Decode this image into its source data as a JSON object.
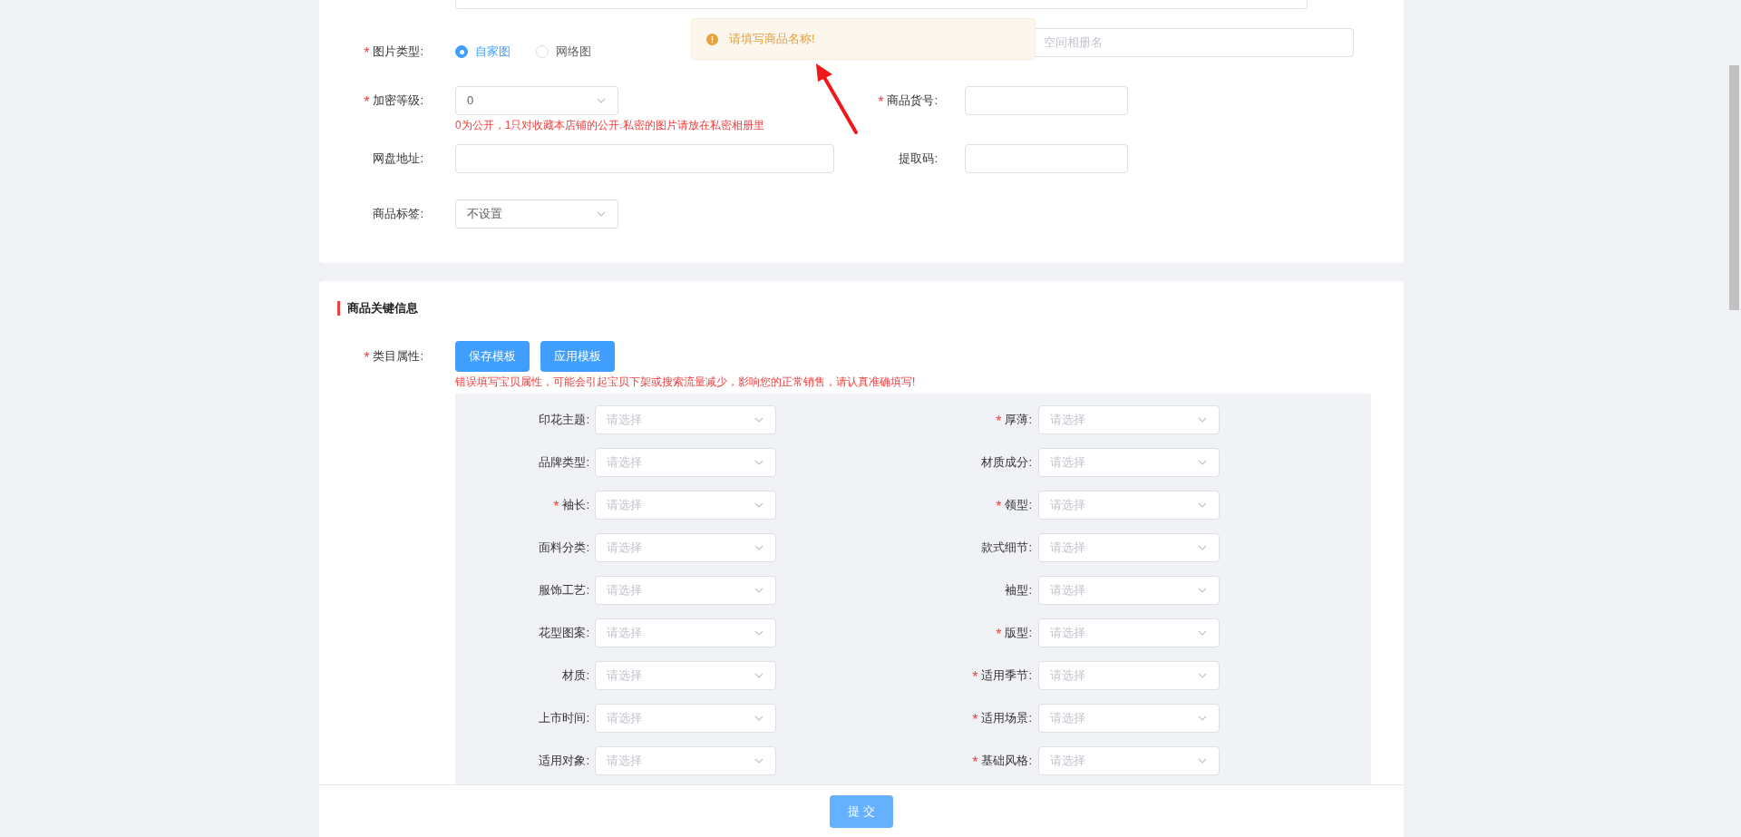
{
  "basic_form": {
    "image_type": {
      "label": "图片类型:",
      "required_mark": "*",
      "options": [
        {
          "label": "自家图",
          "selected": true
        },
        {
          "label": "网络图",
          "selected": false
        }
      ]
    },
    "album_field": {
      "placeholder": "空间相册名"
    },
    "encryption": {
      "label": "加密等级:",
      "required_mark": "*",
      "value": "0",
      "hint": "0为公开，1只对收藏本店铺的公开.私密的图片请放在私密相册里"
    },
    "item_number": {
      "label": "商品货号:",
      "required_mark": "*"
    },
    "netdisk": {
      "label": "网盘地址:"
    },
    "extract_code": {
      "label": "提取码:"
    },
    "tag": {
      "label": "商品标签:",
      "value": "不设置"
    }
  },
  "toast": {
    "message": "请填写商品名称!"
  },
  "key_info": {
    "title": "商品关键信息",
    "category": {
      "label": "类目属性:",
      "required_mark": "*"
    },
    "buttons": [
      "保存模板",
      "应用模板"
    ],
    "warning": "错误填写宝贝属性，可能会引起宝贝下架或搜索流量减少，影响您的正常销售，请认真准确填写!",
    "attributes": [
      {
        "label": "印花主题:",
        "placeholder": "请选择"
      },
      {
        "label": "厚薄:",
        "required_mark": "*",
        "placeholder": "请选择"
      },
      {
        "label": "品牌类型:",
        "placeholder": "请选择"
      },
      {
        "label": "材质成分:",
        "placeholder": "请选择"
      },
      {
        "label": "袖长:",
        "required_mark": "*",
        "placeholder": "请选择"
      },
      {
        "label": "领型:",
        "required_mark": "*",
        "placeholder": "请选择"
      },
      {
        "label": "面料分类:",
        "placeholder": "请选择"
      },
      {
        "label": "款式细节:",
        "placeholder": "请选择"
      },
      {
        "label": "服饰工艺:",
        "placeholder": "请选择"
      },
      {
        "label": "袖型:",
        "placeholder": "请选择"
      },
      {
        "label": "花型图案:",
        "placeholder": "请选择"
      },
      {
        "label": "版型:",
        "required_mark": "*",
        "placeholder": "请选择"
      },
      {
        "label": "材质:",
        "placeholder": "请选择"
      },
      {
        "label": "适用季节:",
        "required_mark": "*",
        "placeholder": "请选择"
      },
      {
        "label": "上市时间:",
        "placeholder": "请选择"
      },
      {
        "label": "适用场景:",
        "required_mark": "*",
        "placeholder": "请选择"
      },
      {
        "label": "适用对象:",
        "placeholder": "请选择"
      },
      {
        "label": "基础风格:",
        "required_mark": "*",
        "placeholder": "请选择"
      }
    ]
  },
  "footer": {
    "submit": "提 交"
  }
}
